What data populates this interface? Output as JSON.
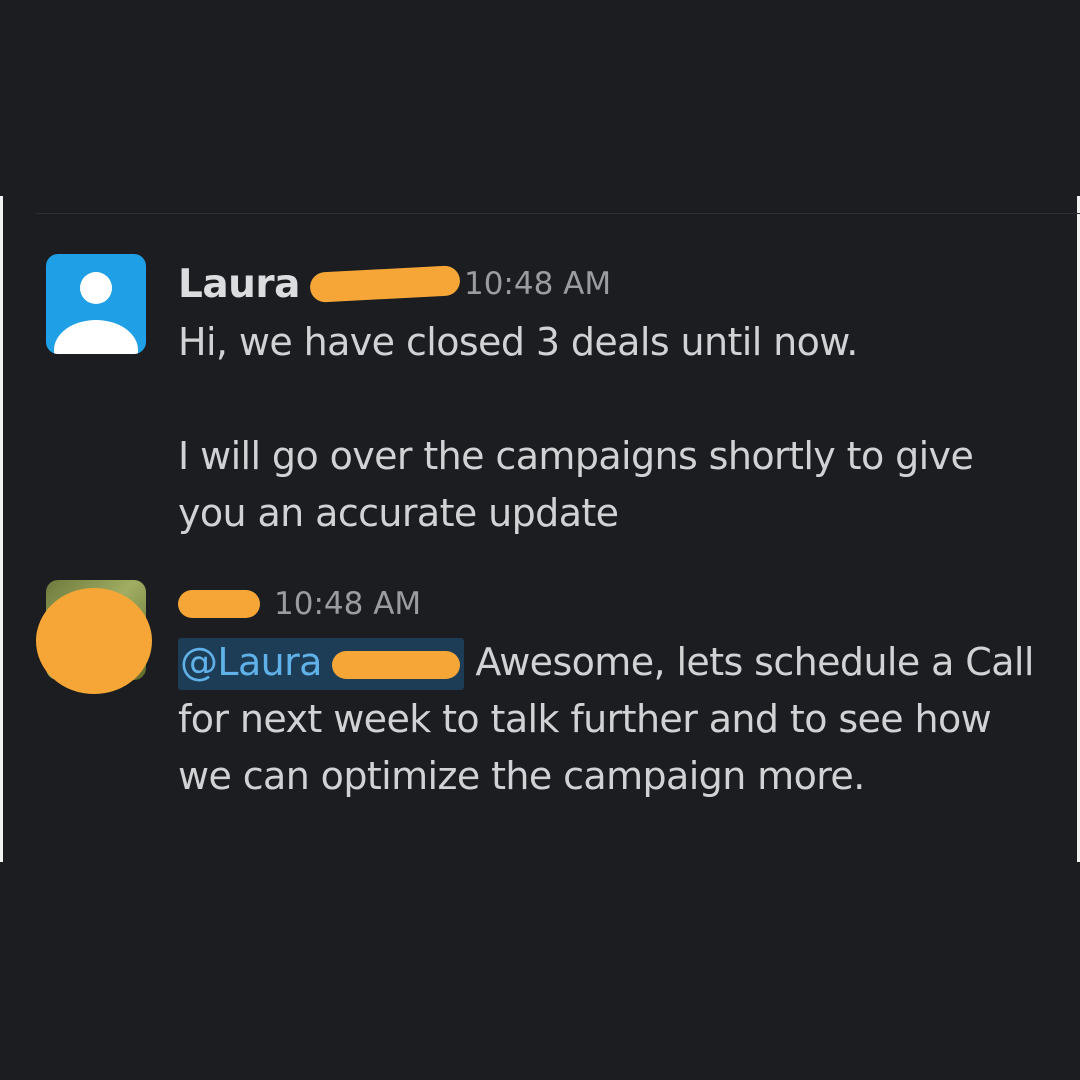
{
  "messages": [
    {
      "author": "Laura",
      "time": "10:48 AM",
      "avatar_icon": "user-silhouette-icon",
      "paragraphs": [
        "Hi, we have closed 3 deals until now.",
        "I will go over the campaigns shortly to give you an accurate update"
      ]
    },
    {
      "time": "10:48 AM",
      "avatar_icon": "photo-avatar",
      "mention": "@Laura",
      "text": "Awesome, lets schedule a Call for next week to talk further and to see how we can optimize the campaign more."
    }
  ],
  "colors": {
    "background": "#1b1d21",
    "text": "#d1d2d3",
    "author": "#dcddde",
    "timestamp": "#9a9c9f",
    "mention_text": "#5fb1e8",
    "mention_bg": "#1d3c56",
    "redaction": "#f5a637",
    "default_avatar": "#1e9fe6"
  }
}
